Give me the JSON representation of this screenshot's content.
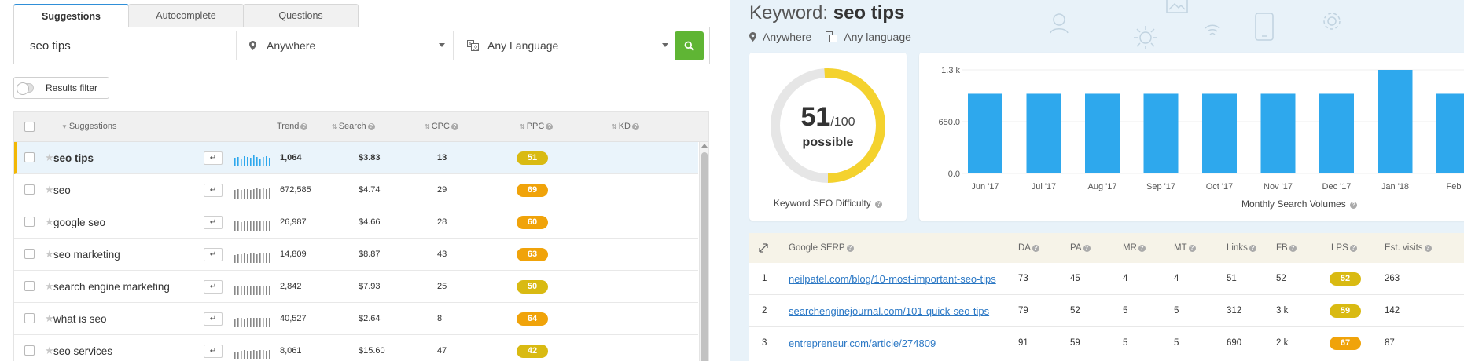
{
  "tabs": [
    {
      "label": "Suggestions",
      "active": true
    },
    {
      "label": "Autocomplete",
      "active": false
    },
    {
      "label": "Questions",
      "active": false
    }
  ],
  "search": {
    "query": "seo tips",
    "location": "Anywhere",
    "language": "Any Language"
  },
  "filter": {
    "label": "Results filter"
  },
  "table": {
    "headers": {
      "suggestions": "Suggestions",
      "trend": "Trend",
      "search": "Search",
      "cpc": "CPC",
      "ppc": "PPC",
      "kd": "KD"
    },
    "rows": [
      {
        "keyword": "seo tips",
        "search": "1,064",
        "cpc": "$3.83",
        "ppc": "13",
        "kd": "51",
        "kd_color": "#d9ba12",
        "selected": true,
        "trend": [
          0.55,
          0.6,
          0.5,
          0.65,
          0.6,
          0.55,
          0.7,
          0.6,
          0.5,
          0.6,
          0.65,
          0.55
        ]
      },
      {
        "keyword": "seo",
        "search": "672,585",
        "cpc": "$4.74",
        "ppc": "29",
        "kd": "69",
        "kd_color": "#f0a30a",
        "selected": false,
        "trend": [
          0.55,
          0.6,
          0.55,
          0.6,
          0.6,
          0.55,
          0.6,
          0.65,
          0.6,
          0.65,
          0.6,
          0.7
        ]
      },
      {
        "keyword": "google seo",
        "search": "26,987",
        "cpc": "$4.66",
        "ppc": "28",
        "kd": "60",
        "kd_color": "#f0a30a",
        "selected": false,
        "trend": [
          0.6,
          0.6,
          0.55,
          0.6,
          0.6,
          0.6,
          0.6,
          0.6,
          0.6,
          0.6,
          0.6,
          0.6
        ]
      },
      {
        "keyword": "seo marketing",
        "search": "14,809",
        "cpc": "$8.87",
        "ppc": "43",
        "kd": "63",
        "kd_color": "#f0a30a",
        "selected": false,
        "trend": [
          0.5,
          0.55,
          0.55,
          0.6,
          0.55,
          0.6,
          0.6,
          0.55,
          0.6,
          0.6,
          0.6,
          0.6
        ]
      },
      {
        "keyword": "search engine marketing",
        "search": "2,842",
        "cpc": "$7.93",
        "ppc": "25",
        "kd": "50",
        "kd_color": "#d9ba12",
        "selected": false,
        "trend": [
          0.6,
          0.55,
          0.6,
          0.55,
          0.6,
          0.6,
          0.55,
          0.6,
          0.6,
          0.55,
          0.6,
          0.6
        ]
      },
      {
        "keyword": "what is seo",
        "search": "40,527",
        "cpc": "$2.64",
        "ppc": "8",
        "kd": "64",
        "kd_color": "#f0a30a",
        "selected": false,
        "trend": [
          0.55,
          0.6,
          0.6,
          0.55,
          0.6,
          0.6,
          0.6,
          0.6,
          0.6,
          0.6,
          0.6,
          0.6
        ]
      },
      {
        "keyword": "seo services",
        "search": "8,061",
        "cpc": "$15.60",
        "ppc": "47",
        "kd": "42",
        "kd_color": "#d9ba12",
        "selected": false,
        "trend": [
          0.5,
          0.5,
          0.55,
          0.6,
          0.55,
          0.55,
          0.6,
          0.55,
          0.6,
          0.6,
          0.55,
          0.6
        ]
      }
    ]
  },
  "detail": {
    "title_prefix": "Keyword:",
    "title_keyword": "seo tips",
    "location": "Anywhere",
    "language": "Any language",
    "difficulty": {
      "value": "51",
      "max": "/100",
      "word": "possible",
      "label": "Keyword SEO Difficulty",
      "fraction": 0.51,
      "color": "#f4d22e"
    },
    "volume_label": "Monthly Search Volumes"
  },
  "chart_data": {
    "type": "bar",
    "categories": [
      "Jun '17",
      "Jul '17",
      "Aug '17",
      "Sep '17",
      "Oct '17",
      "Nov '17",
      "Dec '17",
      "Jan '18",
      "Feb"
    ],
    "values": [
      1000,
      1000,
      1000,
      1000,
      1000,
      1000,
      1000,
      1300,
      1000
    ],
    "ylim": [
      0,
      1300
    ],
    "yticks": [
      "1.3 k",
      "650.0",
      "0.0"
    ],
    "ytick_values": [
      1300,
      650,
      0
    ],
    "color": "#2ea8ed",
    "xlabel": "Monthly Search Volumes"
  },
  "serp": {
    "headers": {
      "title": "Google SERP",
      "da": "DA",
      "pa": "PA",
      "mr": "MR",
      "mt": "MT",
      "links": "Links",
      "fb": "FB",
      "lps": "LPS",
      "visits": "Est. visits"
    },
    "rows": [
      {
        "rank": "1",
        "url": "neilpatel.com/blog/10-most-important-seo-tips",
        "da": "73",
        "pa": "45",
        "mr": "4",
        "mt": "4",
        "links": "51",
        "fb": "52",
        "lps": "52",
        "lps_color": "#d9ba12",
        "visits": "263"
      },
      {
        "rank": "2",
        "url": "searchenginejournal.com/101-quick-seo-tips",
        "da": "79",
        "pa": "52",
        "mr": "5",
        "mt": "5",
        "links": "312",
        "fb": "3 k",
        "lps": "59",
        "lps_color": "#d9ba12",
        "visits": "142"
      },
      {
        "rank": "3",
        "url": "entrepreneur.com/article/274809",
        "da": "91",
        "pa": "59",
        "mr": "5",
        "mt": "5",
        "links": "690",
        "fb": "2 k",
        "lps": "67",
        "lps_color": "#f0a30a",
        "visits": "87"
      }
    ]
  }
}
